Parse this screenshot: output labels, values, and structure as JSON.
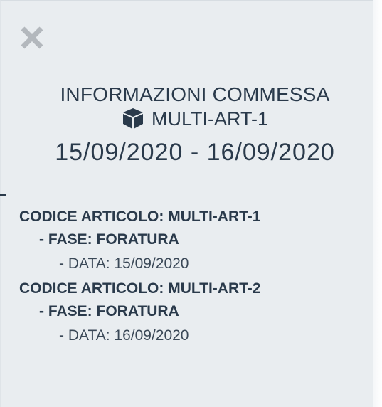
{
  "header": {
    "title": "INFORMAZIONI COMMESSA",
    "order_code": "MULTI-ART-1",
    "date_range": "15/09/2020 - 16/09/2020"
  },
  "icons": {
    "close": "close-icon",
    "box": "box-icon"
  },
  "articles": [
    {
      "title": "CODICE ARTICOLO: MULTI-ART-1",
      "phase": "- FASE: FORATURA",
      "date": "- DATA: 15/09/2020"
    },
    {
      "title": "CODICE ARTICOLO: MULTI-ART-2",
      "phase": "- FASE: FORATURA",
      "date": "- DATA: 16/09/2020"
    }
  ],
  "colors": {
    "panel_background": "#e9edf0",
    "text": "#2a3a4b",
    "close_icon": "#b3b8bd"
  }
}
